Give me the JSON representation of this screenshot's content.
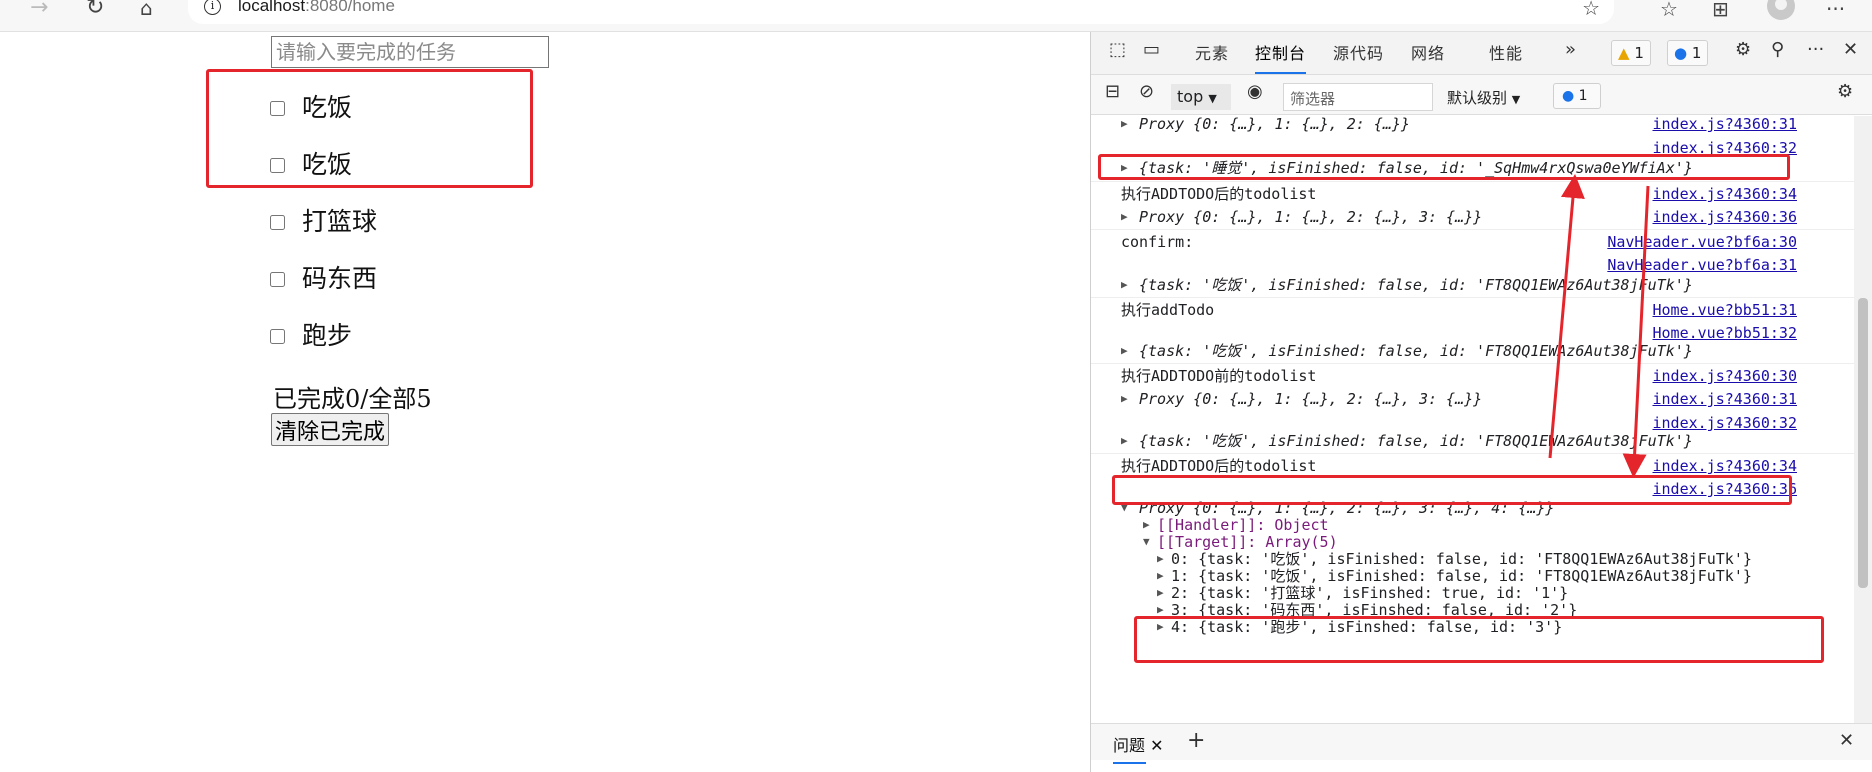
{
  "browser": {
    "url_host": "localhost",
    "url_port": ":8080",
    "url_path": "/home"
  },
  "todo": {
    "input_placeholder": "请输入要完成的任务",
    "items": [
      "吃饭",
      "吃饭",
      "打篮球",
      "码东西",
      "跑步"
    ],
    "summary": "已完成0/全部5",
    "clear_button": "清除已完成"
  },
  "devtools": {
    "tabs": [
      "元素",
      "控制台",
      "源代码",
      "网络",
      "性能"
    ],
    "active_tab": "控制台",
    "warnings_count": "1",
    "messages_count": "1",
    "context": "top",
    "filter_placeholder": "筛选器",
    "level": "默认级别",
    "filter_messages": "1",
    "bottom_tab": "问题",
    "console_lines": [
      {
        "text": "Proxy {0: {…}, 1: {…}, 2: {…}}",
        "source": "index.js?4360:31"
      },
      {
        "text": "",
        "source": "index.js?4360:32"
      },
      {
        "text": "{task: '睡觉', isFinished: false, id: '_SqHmw4rxQswa0eYWfiAx'}",
        "source": ""
      },
      {
        "text": "执行ADDTODO后的todolist",
        "source": "index.js?4360:34"
      },
      {
        "text": "Proxy {0: {…}, 1: {…}, 2: {…}, 3: {…}}",
        "source": "index.js?4360:36"
      },
      {
        "text": "confirm:",
        "source": "NavHeader.vue?bf6a:30"
      },
      {
        "text": "",
        "source": "NavHeader.vue?bf6a:31"
      },
      {
        "text": "{task: '吃饭', isFinished: false, id: 'FT8QQ1EWAz6Aut38jFuTk'}",
        "source": ""
      },
      {
        "text": "执行addTodo",
        "source": "Home.vue?bb51:31"
      },
      {
        "text": "",
        "source": "Home.vue?bb51:32"
      },
      {
        "text": "{task: '吃饭', isFinished: false, id: 'FT8QQ1EWAz6Aut38jFuTk'}",
        "source": ""
      },
      {
        "text": "执行ADDTODO前的todolist",
        "source": "index.js?4360:30"
      },
      {
        "text": "Proxy {0: {…}, 1: {…}, 2: {…}, 3: {…}}",
        "source": "index.js?4360:31"
      },
      {
        "text": "",
        "source": "index.js?4360:32"
      },
      {
        "text": "{task: '吃饭', isFinished: false, id: 'FT8QQ1EWAz6Aut38jFuTk'}",
        "source": ""
      },
      {
        "text": "执行ADDTODO后的todolist",
        "source": "index.js?4360:34"
      },
      {
        "text": "",
        "source": "index.js?4360:36"
      },
      {
        "text": "Proxy {0: {…}, 1: {…}, 2: {…}, 3: {…}, 4: {…}}",
        "source": ""
      }
    ],
    "expanded": {
      "handler": "[[Handler]]: Object",
      "target": "[[Target]]: Array(5)",
      "rows": [
        "0: {task: '吃饭', isFinished: false, id: 'FT8QQ1EWAz6Aut38jFuTk'}",
        "1: {task: '吃饭', isFinished: false, id: 'FT8QQ1EWAz6Aut38jFuTk'}",
        "2: {task: '打篮球', isFinshed: true, id: '1'}",
        "3: {task: '码东西', isFinshed: false, id: '2'}",
        "4: {task: '跑步', isFinshed: false, id: '3'}"
      ]
    }
  },
  "colors": {
    "annotation_red": "#e5252c",
    "link_blue": "#1a0dab",
    "accent_blue": "#1a73e8"
  }
}
